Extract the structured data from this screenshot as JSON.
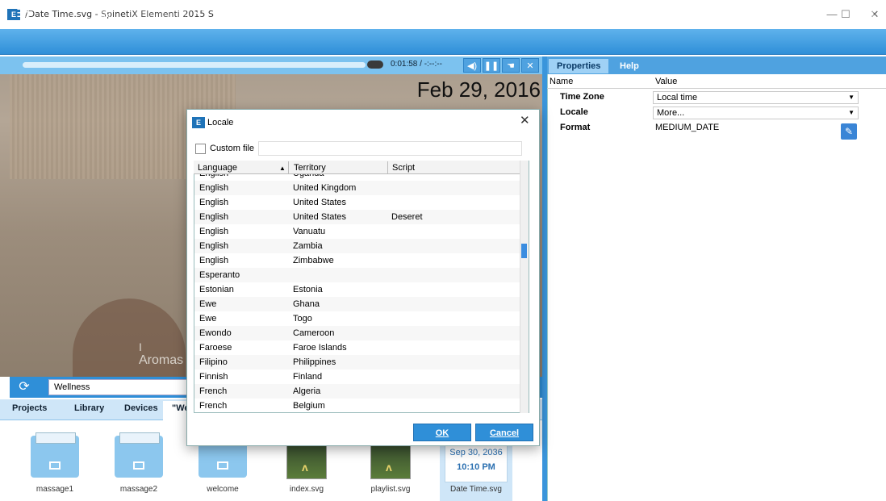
{
  "window": {
    "title": "/Date Time.svg - SpinetiX Elementi 2015 S",
    "app_icon_text": "E",
    "minimize": "—",
    "maximize": "☐",
    "close": "✕"
  },
  "preview": {
    "time_readout": "0:01:58 / -:--:--",
    "date_overlay": "Feb 29, 2016",
    "overlay_text_line1": "I",
    "overlay_text_line2": "Aromas"
  },
  "playlist": {
    "value": "Wellness"
  },
  "bottom_tabs": [
    "Projects",
    "Library",
    "Devices",
    "\"We"
  ],
  "files": [
    {
      "label": "massage1",
      "kind": "folder"
    },
    {
      "label": "massage2",
      "kind": "folder"
    },
    {
      "label": "welcome",
      "kind": "folder"
    },
    {
      "label": "index.svg",
      "kind": "svg"
    },
    {
      "label": "playlist.svg",
      "kind": "svg"
    },
    {
      "label": "Date Time.svg",
      "kind": "datetime",
      "card_date": "Sep 30, 2036",
      "card_time": "10:10 PM"
    }
  ],
  "properties": {
    "tabs": [
      "Properties",
      "Help"
    ],
    "columns": [
      "Name",
      "Value"
    ],
    "rows": [
      {
        "name": "Time Zone",
        "value": "Local time"
      },
      {
        "name": "Locale",
        "value": "More..."
      },
      {
        "name": "Format",
        "value": "MEDIUM_DATE"
      }
    ]
  },
  "dialog": {
    "title": "Locale",
    "icon_text": "E",
    "close": "✕",
    "custom_file_label": "Custom file",
    "custom_file_value": "",
    "columns": [
      "Language",
      "Territory",
      "Script"
    ],
    "sort_indicator": "▲",
    "rows": [
      [
        "English",
        "Uganda",
        ""
      ],
      [
        "English",
        "United Kingdom",
        ""
      ],
      [
        "English",
        "United States",
        ""
      ],
      [
        "English",
        "United States",
        "Deseret"
      ],
      [
        "English",
        "Vanuatu",
        ""
      ],
      [
        "English",
        "Zambia",
        ""
      ],
      [
        "English",
        "Zimbabwe",
        ""
      ],
      [
        "Esperanto",
        "",
        ""
      ],
      [
        "Estonian",
        "Estonia",
        ""
      ],
      [
        "Ewe",
        "Ghana",
        ""
      ],
      [
        "Ewe",
        "Togo",
        ""
      ],
      [
        "Ewondo",
        "Cameroon",
        ""
      ],
      [
        "Faroese",
        "Faroe Islands",
        ""
      ],
      [
        "Filipino",
        "Philippines",
        ""
      ],
      [
        "Finnish",
        "Finland",
        ""
      ],
      [
        "French",
        "Algeria",
        ""
      ],
      [
        "French",
        "Belgium",
        ""
      ]
    ],
    "ok_label": "OK",
    "cancel_label": "Cancel"
  },
  "colors": {
    "accent": "#2f8fd8",
    "toolbar": "#4fa2e0",
    "selected_tile": "#cfe6f8"
  }
}
